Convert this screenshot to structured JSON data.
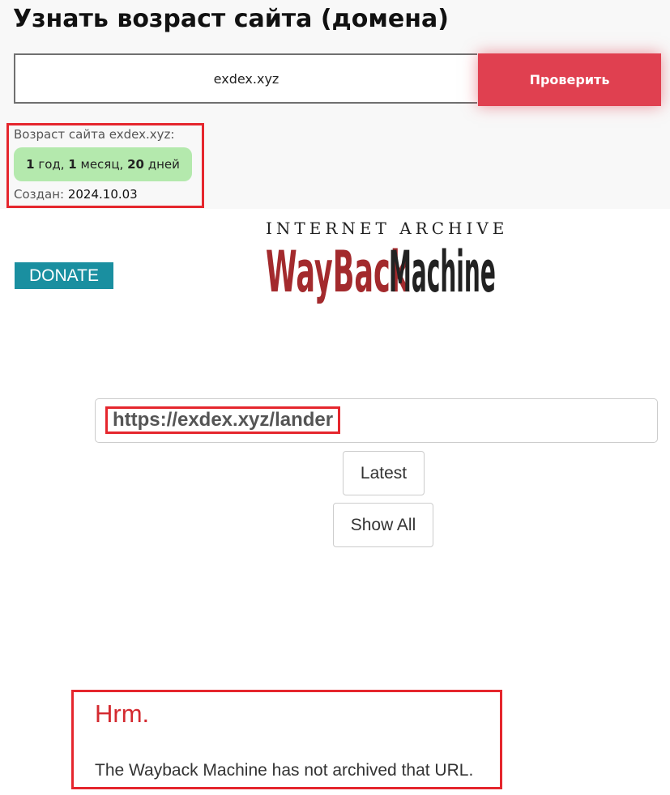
{
  "domain_checker": {
    "title": "Узнать возраст сайта (домена)",
    "input_value": "exdex.xyz",
    "check_button_label": "Проверить",
    "result": {
      "age_label": "Возраст сайта exdex.xyz:",
      "years_value": "1",
      "years_unit": "год",
      "months_value": "1",
      "months_unit": "месяц",
      "days_value": "20",
      "days_unit": "дней",
      "created_label": "Создан:",
      "created_date": "2024.10.03"
    }
  },
  "wayback": {
    "donate_label": "DONATE",
    "logo": {
      "top_text": "INTERNET ARCHIVE",
      "word_1": "WayBack",
      "word_2": "Machine"
    },
    "url_value": "https://exdex.xyz/lander",
    "latest_label": "Latest",
    "show_all_label": "Show All",
    "error_title": "Hrm.",
    "error_message": "The Wayback Machine has not archived that URL."
  },
  "colors": {
    "check_button": "#e04050",
    "age_badge": "#b4e9ad",
    "highlight_border": "#e5262d",
    "donate_button": "#1a8fa0",
    "logo_red": "#a32a2d",
    "error_title": "#d42a30"
  }
}
